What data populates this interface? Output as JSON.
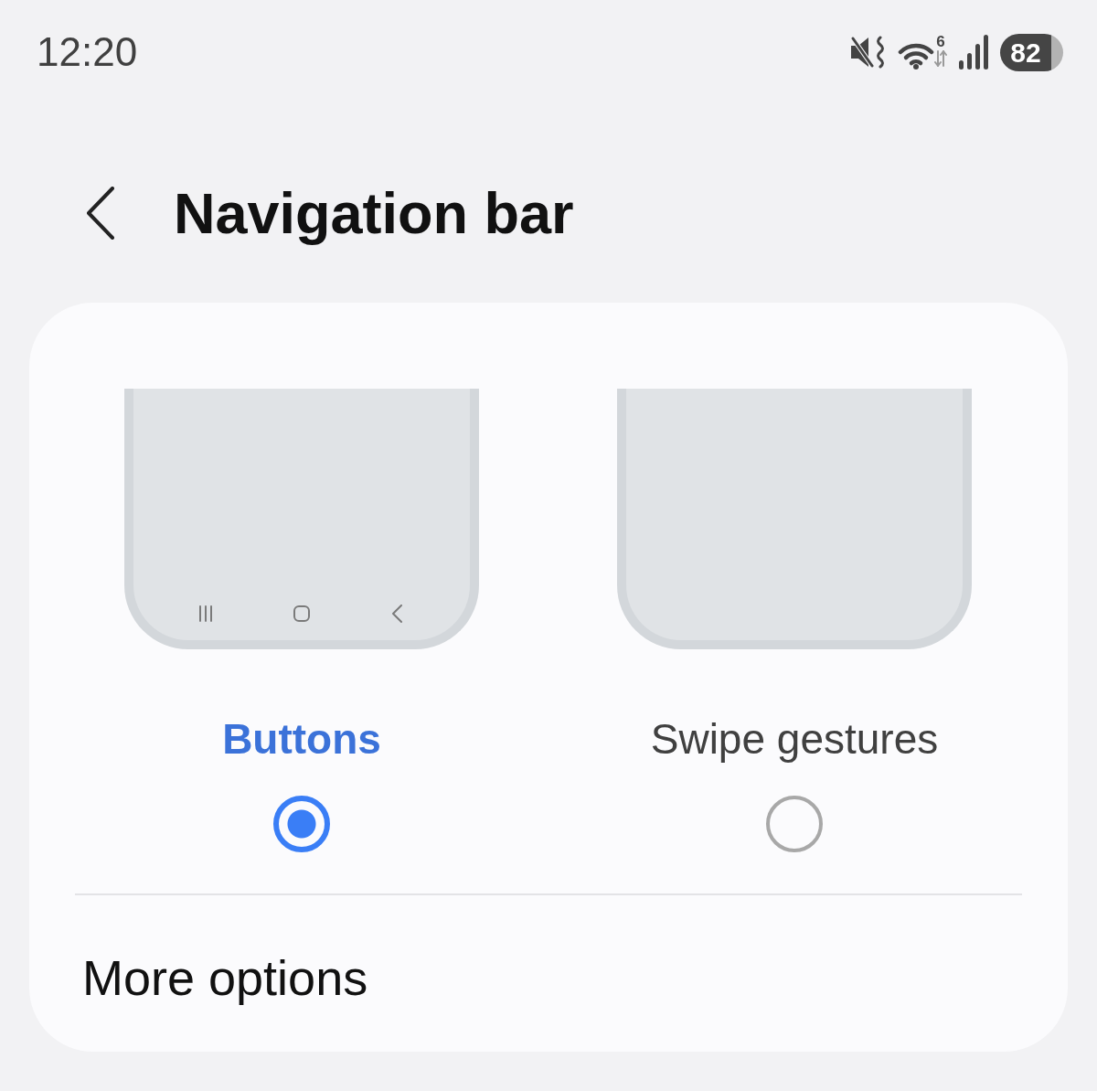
{
  "status_bar": {
    "time": "12:20",
    "wifi_badge": "6",
    "battery": "82"
  },
  "header": {
    "title": "Navigation bar"
  },
  "options": [
    {
      "kind": "buttons",
      "label": "Buttons",
      "selected": true
    },
    {
      "kind": "gestures",
      "label": "Swipe gestures",
      "selected": false
    }
  ],
  "more_options": {
    "label": "More options"
  }
}
